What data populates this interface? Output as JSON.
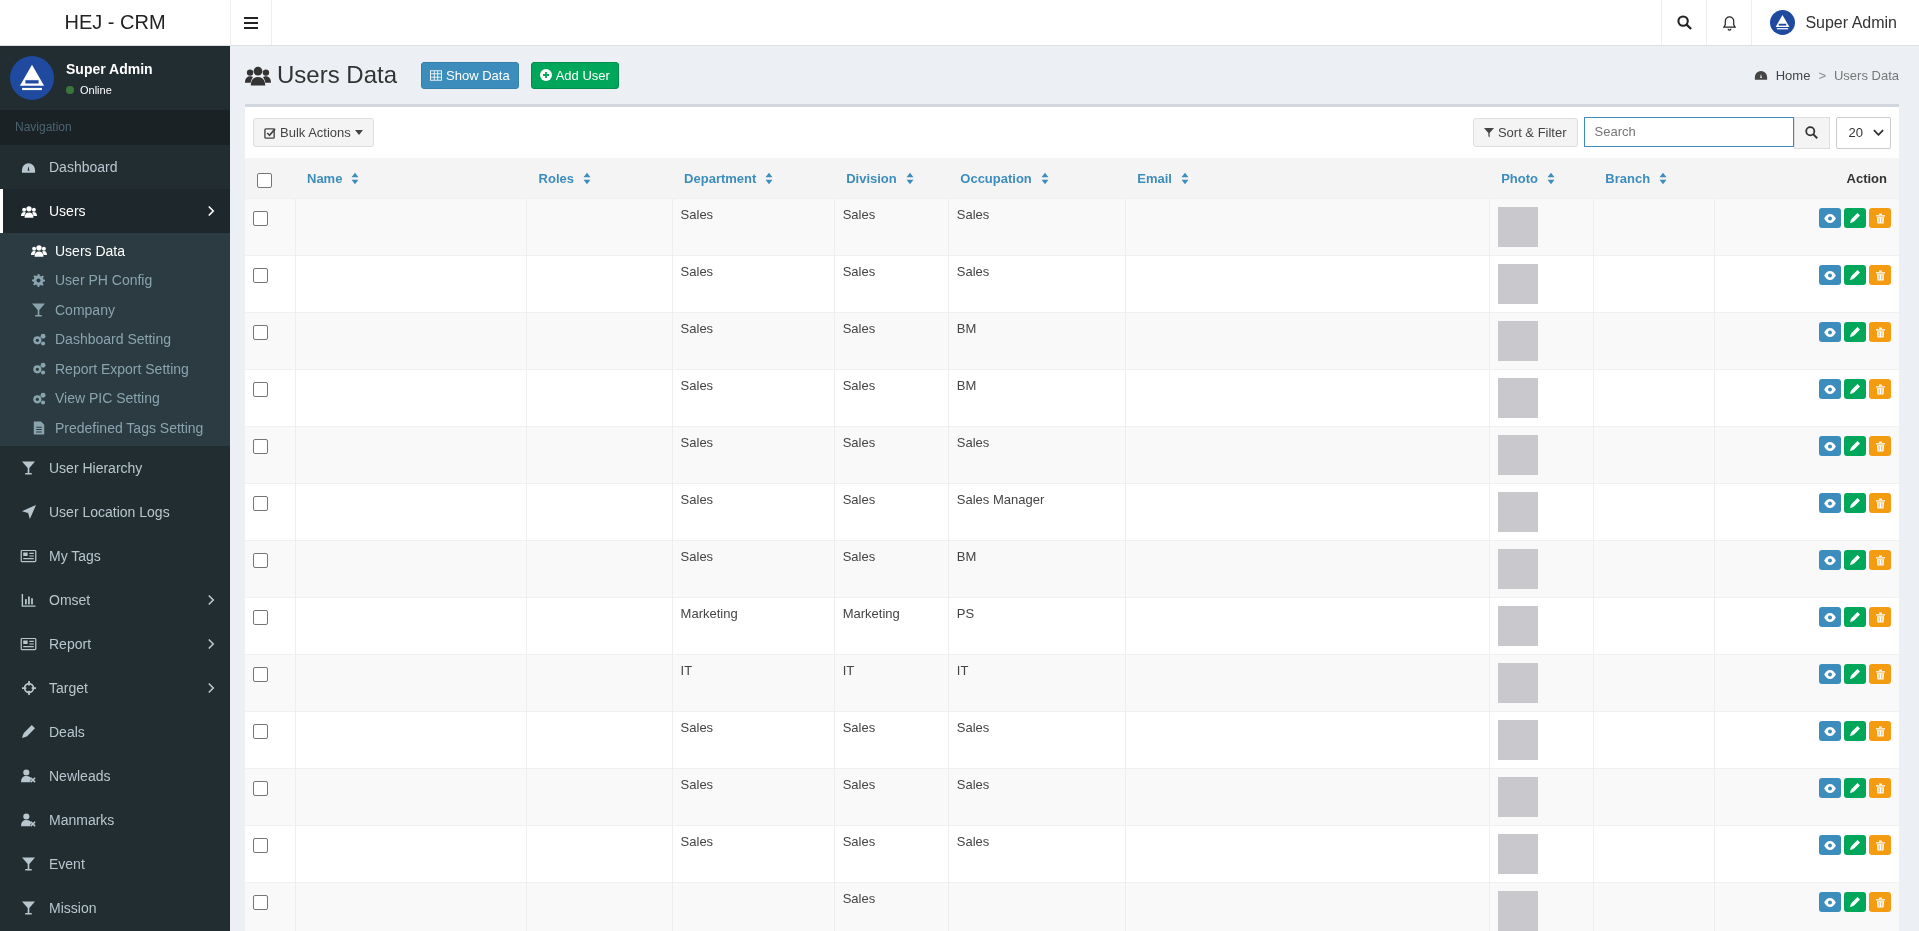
{
  "brand": "HEJ - CRM",
  "topbar": {
    "user_name": "Super Admin"
  },
  "sidebar": {
    "user": {
      "name": "Super Admin",
      "status": "Online",
      "online": true
    },
    "section": "Navigation",
    "items": [
      {
        "label": "Dashboard",
        "selected": false,
        "has_submenu": false
      },
      {
        "label": "Users",
        "selected": true,
        "has_submenu": true,
        "expanded": true,
        "children": [
          {
            "label": "Users Data",
            "selected": true
          },
          {
            "label": "User PH Config",
            "selected": false
          },
          {
            "label": "Company",
            "selected": false
          },
          {
            "label": "Dashboard Setting",
            "selected": false
          },
          {
            "label": "Report Export Setting",
            "selected": false
          },
          {
            "label": "View PIC Setting",
            "selected": false
          },
          {
            "label": "Predefined Tags Setting",
            "selected": false
          }
        ]
      },
      {
        "label": "User Hierarchy",
        "selected": false,
        "has_submenu": false
      },
      {
        "label": "User Location Logs",
        "selected": false,
        "has_submenu": false
      },
      {
        "label": "My Tags",
        "selected": false,
        "has_submenu": false
      },
      {
        "label": "Omset",
        "selected": false,
        "has_submenu": true,
        "expanded": false
      },
      {
        "label": "Report",
        "selected": false,
        "has_submenu": true,
        "expanded": false
      },
      {
        "label": "Target",
        "selected": false,
        "has_submenu": true,
        "expanded": false
      },
      {
        "label": "Deals",
        "selected": false,
        "has_submenu": false
      },
      {
        "label": "Newleads",
        "selected": false,
        "has_submenu": false
      },
      {
        "label": "Manmarks",
        "selected": false,
        "has_submenu": false
      },
      {
        "label": "Event",
        "selected": false,
        "has_submenu": false
      },
      {
        "label": "Mission",
        "selected": false,
        "has_submenu": false
      }
    ]
  },
  "page": {
    "title": "Users Data",
    "buttons": [
      "Show Data",
      "Add User"
    ],
    "breadcrumb": {
      "items": [
        "Home",
        "Users Data"
      ],
      "separator": ">"
    }
  },
  "toolbar": {
    "bulk": "Bulk Actions",
    "sort": "Sort & Filter",
    "search_placeholder": "Search",
    "page_size": "20"
  },
  "table": {
    "select_all_checked": false,
    "columns": [
      {
        "label": "Name",
        "sortable": true
      },
      {
        "label": "Roles",
        "sortable": true
      },
      {
        "label": "Department",
        "sortable": true
      },
      {
        "label": "Division",
        "sortable": true
      },
      {
        "label": "Occupation",
        "sortable": true
      },
      {
        "label": "Email",
        "sortable": true
      },
      {
        "label": "Photo",
        "sortable": true
      },
      {
        "label": "Branch",
        "sortable": true
      },
      {
        "label": "Action",
        "sortable": false
      }
    ],
    "rows": [
      {
        "checked": false,
        "department": "Sales",
        "division": "Sales",
        "occupation": "Sales"
      },
      {
        "checked": false,
        "department": "Sales",
        "division": "Sales",
        "occupation": "Sales"
      },
      {
        "checked": false,
        "department": "Sales",
        "division": "Sales",
        "occupation": "BM"
      },
      {
        "checked": false,
        "department": "Sales",
        "division": "Sales",
        "occupation": "BM"
      },
      {
        "checked": false,
        "department": "Sales",
        "division": "Sales",
        "occupation": "Sales"
      },
      {
        "checked": false,
        "department": "Sales",
        "division": "Sales",
        "occupation": "Sales Manager"
      },
      {
        "checked": false,
        "department": "Sales",
        "division": "Sales",
        "occupation": "BM"
      },
      {
        "checked": false,
        "department": "Marketing",
        "division": "Marketing",
        "occupation": "PS"
      },
      {
        "checked": false,
        "department": "IT",
        "division": "IT",
        "occupation": "IT"
      },
      {
        "checked": false,
        "department": "Sales",
        "division": "Sales",
        "occupation": "Sales"
      },
      {
        "checked": false,
        "department": "Sales",
        "division": "Sales",
        "occupation": "Sales"
      },
      {
        "checked": false,
        "department": "Sales",
        "division": "Sales",
        "occupation": "Sales"
      },
      {
        "checked": false,
        "division": "Sales"
      }
    ]
  }
}
